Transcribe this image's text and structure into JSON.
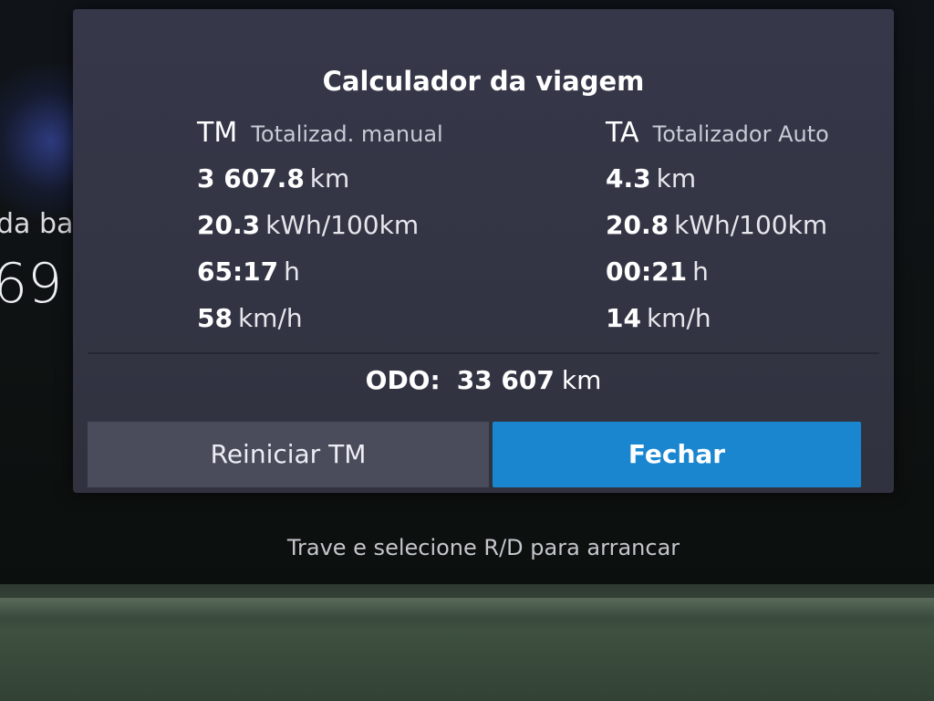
{
  "background": {
    "left_text": "da ba",
    "left_number": "69"
  },
  "dialog": {
    "title": "Calculador da viagem",
    "tm": {
      "abbr": "TM",
      "label": "Totalizad. manual",
      "distance": {
        "value": "3 607.8",
        "unit": "km"
      },
      "consumption": {
        "value": "20.3",
        "unit": "kWh/100km"
      },
      "time": {
        "value": "65:17",
        "unit": "h"
      },
      "speed": {
        "value": "58",
        "unit": "km/h"
      }
    },
    "ta": {
      "abbr": "TA",
      "label": "Totalizador Auto",
      "distance": {
        "value": "4.3",
        "unit": "km"
      },
      "consumption": {
        "value": "20.8",
        "unit": "kWh/100km"
      },
      "time": {
        "value": "00:21",
        "unit": "h"
      },
      "speed": {
        "value": "14",
        "unit": "km/h"
      }
    },
    "odo": {
      "label": "ODO:",
      "value": "33 607",
      "unit": "km"
    },
    "buttons": {
      "reset_label": "Reiniciar TM",
      "close_label": "Fechar"
    }
  },
  "hint_text": "Trave e selecione R/D para arrancar",
  "colors": {
    "dialog_bg": "#33354a",
    "primary_button": "#1a86d0",
    "secondary_button": "#4a4c5c"
  }
}
